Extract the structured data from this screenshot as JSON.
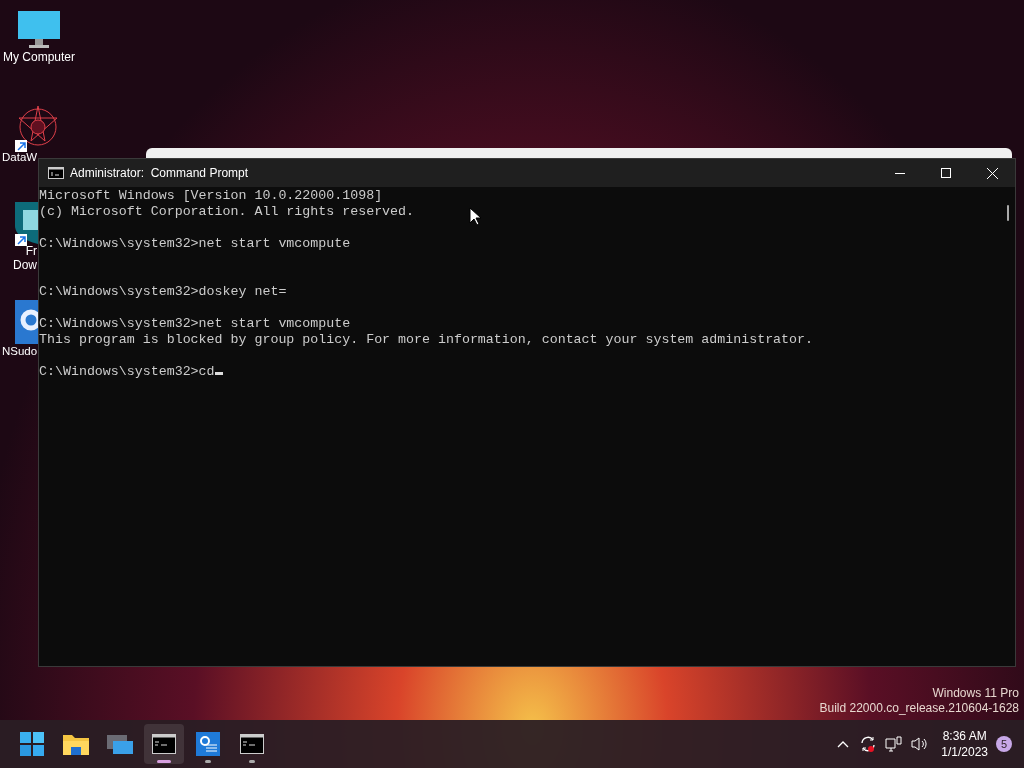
{
  "desktop_icons": [
    {
      "kind": "monitor",
      "lines": [
        "My Computer"
      ],
      "shortcut": false
    },
    {
      "kind": "star",
      "lines": [
        "DataW"
      ],
      "shortcut": true
    },
    {
      "kind": "shield",
      "lines": [
        "Fr",
        "Dow"
      ],
      "shortcut": true
    },
    {
      "kind": "gear",
      "lines": [
        "NSudo"
      ],
      "shortcut": false
    }
  ],
  "window": {
    "title": "Administrator:  Command Prompt",
    "lines": [
      {
        "kind": "text",
        "text": "Microsoft Windows [Version 10.0.22000.1098]"
      },
      {
        "kind": "text",
        "text": "(c) Microsoft Corporation. All rights reserved."
      },
      {
        "kind": "blank"
      },
      {
        "kind": "text",
        "text": "C:\\Windows\\system32>net start vmcompute"
      },
      {
        "kind": "blank"
      },
      {
        "kind": "blank"
      },
      {
        "kind": "text",
        "text": "C:\\Windows\\system32>doskey net="
      },
      {
        "kind": "blank"
      },
      {
        "kind": "text",
        "text": "C:\\Windows\\system32>net start vmcompute"
      },
      {
        "kind": "text",
        "text": "This program is blocked by group policy. For more information, contact your system administrator."
      },
      {
        "kind": "blank"
      },
      {
        "kind": "text",
        "text": "C:\\Windows\\system32>cd"
      }
    ]
  },
  "watermark_os": [
    "Windows 11 Pro",
    "Build 22000.co_release.210604-1628"
  ],
  "taskbar": {
    "items": [
      {
        "kind": "start",
        "running": false,
        "active": false
      },
      {
        "kind": "folder",
        "running": false,
        "active": false
      },
      {
        "kind": "taskview",
        "running": false,
        "active": false
      },
      {
        "kind": "console",
        "running": true,
        "active": true
      },
      {
        "kind": "settings",
        "running": true,
        "active": false
      },
      {
        "kind": "console",
        "running": true,
        "active": false
      }
    ],
    "time": "8:36 AM",
    "date": "1/1/2023",
    "notifications": "5"
  }
}
